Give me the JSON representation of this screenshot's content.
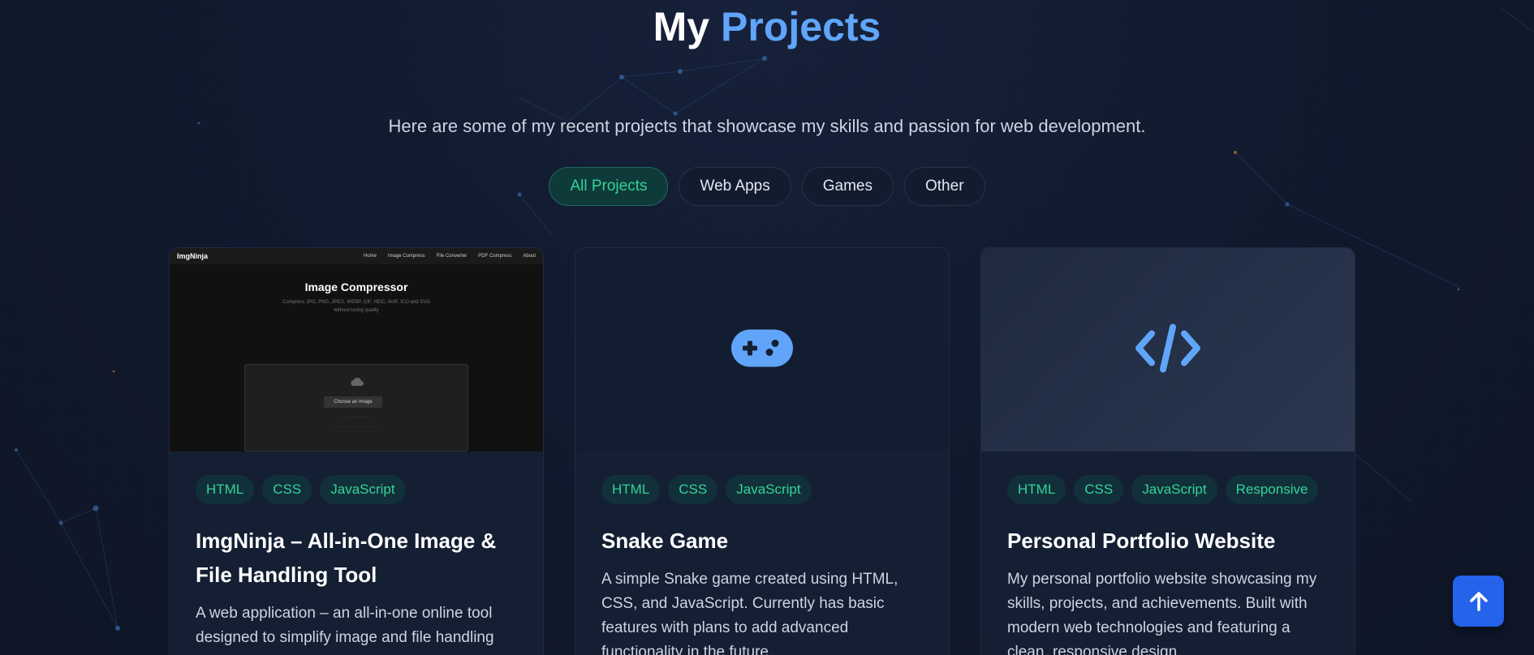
{
  "header": {
    "title_plain": "My",
    "title_accent": "Projects",
    "subtitle": "Here are some of my recent projects that showcase my skills and passion for web development."
  },
  "filters": [
    {
      "label": "All Projects",
      "active": true
    },
    {
      "label": "Web Apps",
      "active": false
    },
    {
      "label": "Games",
      "active": false
    },
    {
      "label": "Other",
      "active": false
    }
  ],
  "projects": [
    {
      "media": "screenshot",
      "tags": [
        "HTML",
        "CSS",
        "JavaScript"
      ],
      "title": "ImgNinja – All-in-One Image & File Handling Tool",
      "description": "A web application – an all-in-one online tool designed to simplify image and file handling",
      "screenshot": {
        "logo": "ImgNinja",
        "nav": [
          "Home",
          "Image Compress",
          "File Converter",
          "PDF Compress",
          "About"
        ],
        "heading": "Image Compressor",
        "text": "Compress JPG, PNG, JPEG, WEBP, GIF, HEIC, AVIF, ICO and SVG without losing quality",
        "button": "Choose an Image"
      }
    },
    {
      "media": "gamepad-icon",
      "tags": [
        "HTML",
        "CSS",
        "JavaScript"
      ],
      "title": "Snake Game",
      "description": "A simple Snake game created using HTML, CSS, and JavaScript. Currently has basic features with plans to add advanced functionality in the future."
    },
    {
      "media": "code-icon",
      "tags": [
        "HTML",
        "CSS",
        "JavaScript",
        "Responsive"
      ],
      "title": "Personal Portfolio Website",
      "description": "My personal portfolio website showcasing my skills, projects, and achievements. Built with modern web technologies and featuring a clean, responsive design."
    }
  ],
  "colors": {
    "accent_blue": "#60a5fa",
    "tag_green": "#34d399",
    "scroll_button": "#2563eb"
  },
  "scroll_top_icon": "arrow-up-icon"
}
